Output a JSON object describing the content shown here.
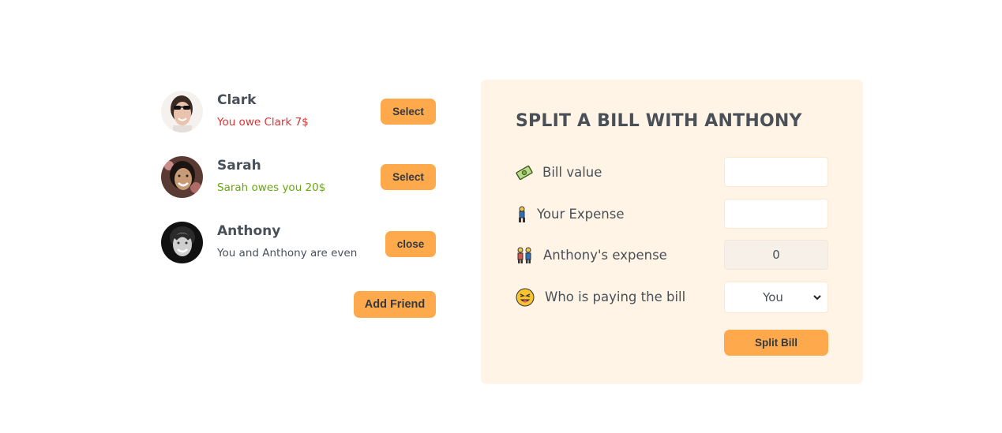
{
  "friends": [
    {
      "name": "Clark",
      "status": "You owe Clark 7$",
      "status_tone": "red",
      "action": "Select"
    },
    {
      "name": "Sarah",
      "status": "Sarah owes you 20$",
      "status_tone": "green",
      "action": "Select"
    },
    {
      "name": "Anthony",
      "status": "You and Anthony are even",
      "status_tone": "gray",
      "action": "close"
    }
  ],
  "add_friend_label": "Add Friend",
  "split_form": {
    "title": "SPLIT A BILL WITH ANTHONY",
    "bill_value": {
      "icon": "money-icon",
      "label": "Bill value",
      "value": ""
    },
    "your_expense": {
      "icon": "person-icon",
      "label": "Your Expense",
      "value": ""
    },
    "friend_expense": {
      "icon": "couple-icon",
      "label": "Anthony's expense",
      "value": "0"
    },
    "payer": {
      "icon": "face-icon",
      "label": "Who is paying the bill",
      "selected": "You"
    },
    "submit_label": "Split Bill"
  },
  "colors": {
    "accent": "#ffa94d",
    "panel": "#fff4e6",
    "owe": "#e03131",
    "owed": "#66a80f"
  }
}
